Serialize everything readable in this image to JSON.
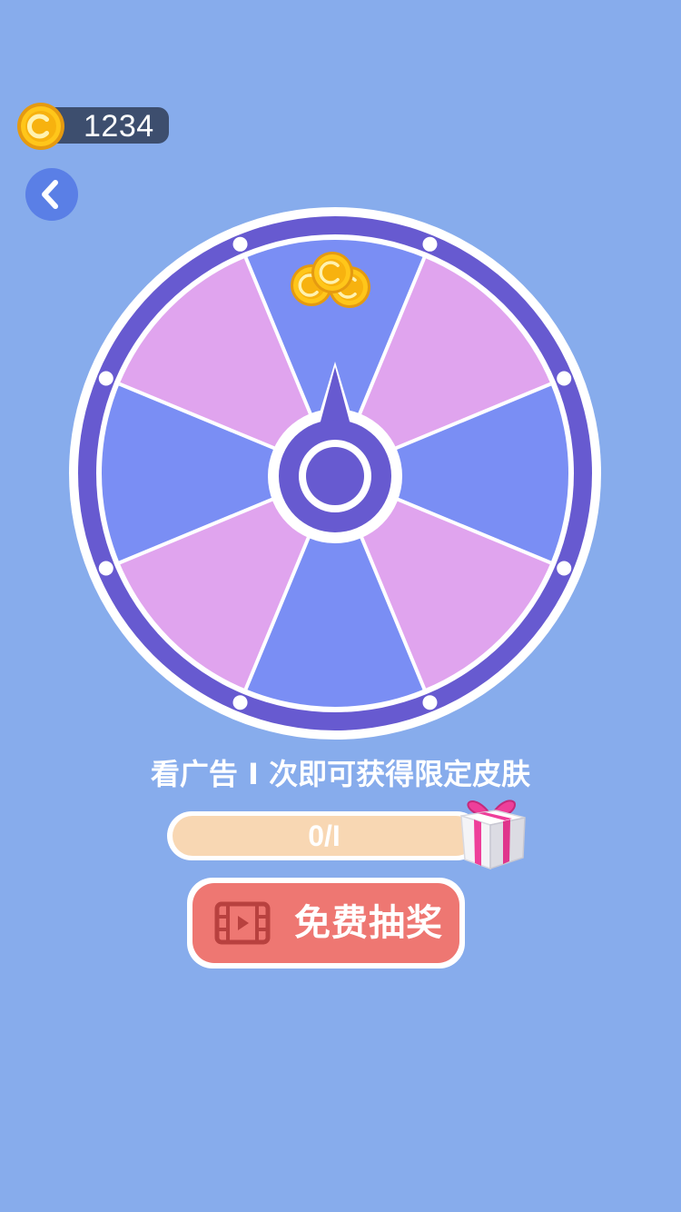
{
  "balance": {
    "coins": "1234",
    "icon": "coin-icon"
  },
  "nav": {
    "back_icon": "chevron-left-icon"
  },
  "wheel": {
    "segment_count": 8,
    "segments": [
      {
        "prize": "coins",
        "color": "#7a8ef4",
        "icon": "coin-pile-icon"
      },
      {
        "prize": "",
        "color": "#e0a4ee"
      },
      {
        "prize": "",
        "color": "#7a8ef4"
      },
      {
        "prize": "",
        "color": "#e0a4ee"
      },
      {
        "prize": "",
        "color": "#7a8ef4"
      },
      {
        "prize": "",
        "color": "#e0a4ee"
      },
      {
        "prize": "",
        "color": "#7a8ef4"
      },
      {
        "prize": "",
        "color": "#e0a4ee"
      }
    ],
    "rim_color": "#675ad0",
    "pointer_color": "#675ad0"
  },
  "promo": {
    "hint": "看广告 I 次即可获得限定皮肤",
    "progress_text": "0/I",
    "progress_value": 0,
    "progress_max": 1,
    "gift_icon": "gift-box-icon"
  },
  "action": {
    "label": "免费抽奖",
    "icon": "video-film-icon",
    "color": "#ee7772"
  }
}
